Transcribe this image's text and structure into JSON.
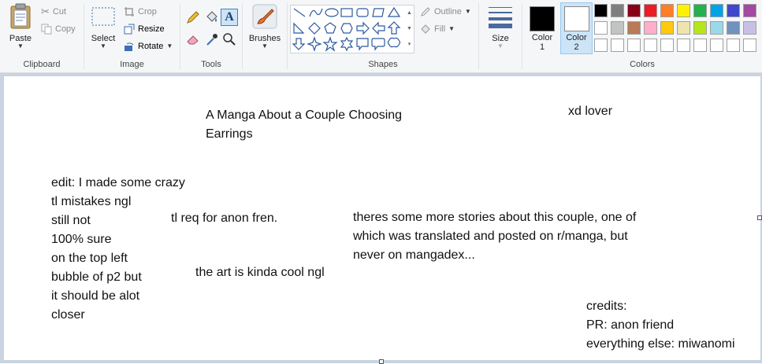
{
  "ribbon": {
    "clipboard": {
      "group_label": "Clipboard",
      "paste": "Paste",
      "cut": "Cut",
      "copy": "Copy"
    },
    "image": {
      "group_label": "Image",
      "select": "Select",
      "crop": "Crop",
      "resize": "Resize",
      "rotate": "Rotate"
    },
    "tools": {
      "group_label": "Tools"
    },
    "brushes": {
      "label": "Brushes"
    },
    "shapes": {
      "group_label": "Shapes",
      "outline": "Outline",
      "fill": "Fill"
    },
    "size": {
      "label": "Size"
    },
    "colors": {
      "group_label": "Colors",
      "color1_label": "Color",
      "color1_num": "1",
      "color1_value": "#000000",
      "color2_label": "Color",
      "color2_num": "2",
      "color2_value": "#ffffff",
      "palette_row1": [
        "#000000",
        "#7f7f7f",
        "#880015",
        "#ed1c24",
        "#ff7f27",
        "#fff200",
        "#22b14c",
        "#00a2e8",
        "#3f48cc",
        "#a349a4"
      ],
      "palette_row2": [
        "#ffffff",
        "#c3c3c3",
        "#b97a57",
        "#ffaec9",
        "#ffc90e",
        "#efe4b0",
        "#b5e61d",
        "#99d9ea",
        "#7092be",
        "#c8bfe7"
      ]
    }
  },
  "canvas": {
    "title_text": "A Manga About a Couple Choosing\nEarrings",
    "xd_text": "xd lover",
    "edit_text": "edit: I made some crazy\ntl mistakes ngl\nstill not\n100% sure\non the top left\nbubble of p2 but\nit should be alot\ncloser",
    "request_text": "tl req for anon fren.",
    "art_text": "the art is kinda cool ngl",
    "stories_text": "theres some more stories about this couple, one of\nwhich was translated and posted on r/manga, but\nnever on mangadex...",
    "credits_text": "credits:\nPR: anon friend\neverything else: miwanomi"
  }
}
